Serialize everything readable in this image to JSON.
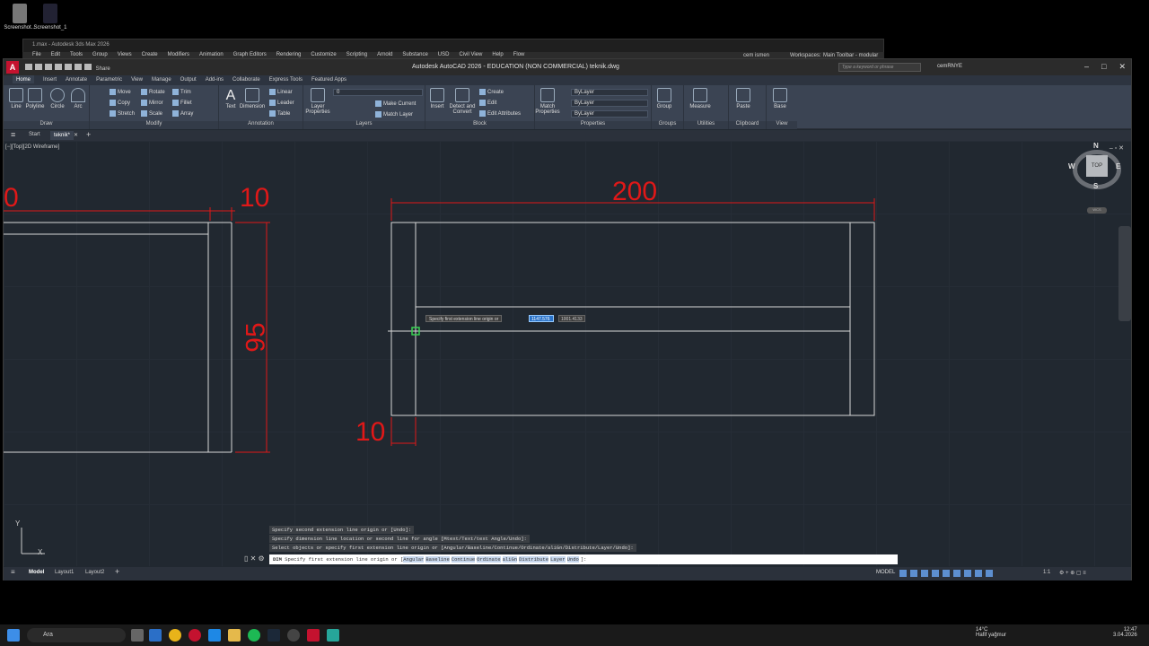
{
  "desktop": {
    "icons": [
      "Screenshot...",
      "Screenshot_1"
    ]
  },
  "max_window": {
    "title": "1.max - Autodesk 3ds Max 2026",
    "menu": [
      "File",
      "Edit",
      "Tools",
      "Group",
      "Views",
      "Create",
      "Modifiers",
      "Animation",
      "Graph Editors",
      "Rendering",
      "Customize",
      "Scripting",
      "Arnold",
      "Substance",
      "USD",
      "Civil View",
      "Help",
      "Flow"
    ],
    "user": "cem ismen",
    "workspace_label": "Workspaces:",
    "workspace_value": "Main Toolbar - modular"
  },
  "acad": {
    "title": "Autodesk AutoCAD 2026 - EDUCATION (NON COMMERCIAL)    teknik.dwg",
    "qat_share": "Share",
    "search_placeholder": "Type a keyword or phrase",
    "user": "cemRNYE",
    "ribbon_tabs": [
      "Home",
      "Insert",
      "Annotate",
      "Parametric",
      "View",
      "Manage",
      "Output",
      "Add-ins",
      "Collaborate",
      "Express Tools",
      "Featured Apps"
    ],
    "active_tab": "Home",
    "panels": {
      "draw": {
        "label": "Draw",
        "tools": [
          "Line",
          "Polyline",
          "Circle",
          "Arc"
        ]
      },
      "modify": {
        "label": "Modify",
        "tools": [
          "Move",
          "Rotate",
          "Trim",
          "Copy",
          "Mirror",
          "Fillet",
          "Stretch",
          "Scale",
          "Array"
        ]
      },
      "annotation": {
        "label": "Annotation",
        "tools": [
          "Text",
          "Dimension",
          "Linear",
          "Leader",
          "Table"
        ]
      },
      "layers": {
        "label": "Layers",
        "tools": [
          "Layer Properties",
          "Make Current",
          "Match Layer"
        ],
        "current_layer": "0"
      },
      "block": {
        "label": "Block",
        "tools": [
          "Insert",
          "Detect and Convert",
          "Create",
          "Edit",
          "Edit Attributes"
        ]
      },
      "properties": {
        "label": "Properties",
        "tools": [
          "Match Properties"
        ],
        "color": "ByLayer",
        "linetype": "ByLayer",
        "lineweight": "ByLayer"
      },
      "groups": {
        "label": "Groups",
        "tools": [
          "Group"
        ]
      },
      "utilities": {
        "label": "Utilities",
        "tools": [
          "Measure"
        ]
      },
      "clipboard": {
        "label": "Clipboard",
        "tools": [
          "Paste"
        ]
      },
      "view": {
        "label": "View",
        "tools": [
          "Base"
        ]
      }
    },
    "doc_tabs": [
      "Start",
      "teknik*"
    ],
    "viewport_label": "[−][Top][2D Wireframe]",
    "dimensions": {
      "top_width": "200",
      "left_top": "10",
      "left_partial": "0",
      "left_height": "95",
      "bottom_small": "10"
    },
    "tooltip": {
      "prompt": "Specify first extension line origin or",
      "x_value": "1147.576",
      "y_value": "1001.4133"
    },
    "viewcube": {
      "top": "TOP",
      "n": "N",
      "s": "S",
      "e": "E",
      "w": "W",
      "wcs": "WCS"
    },
    "ucs": {
      "x": "X",
      "y": "Y"
    },
    "command_history": [
      "Specify second extension line origin or [Undo]:",
      "Specify dimension line location or second line for angle [Mtext/Text/text Angle/Undo]:",
      "Select objects or specify first extension line origin or [Angular/Baseline/Continue/Ordinate/aliGn/Distribute/Layer/Undo]:"
    ],
    "command_input": {
      "prefix": "DIM",
      "prompt": "Specify first extension line origin or [",
      "options": [
        "Angular",
        "Baseline",
        "Continue",
        "Ordinate",
        "aliGn",
        "Distribute",
        "Layer",
        "Undo"
      ],
      "suffix": "]:"
    },
    "status": {
      "layout_tabs": [
        "Model",
        "Layout1",
        "Layout2"
      ],
      "active_layout": "Model",
      "mode": "MODEL",
      "scale": "1:1"
    }
  },
  "taskbar": {
    "search": "Ara",
    "weather_temp": "14°C",
    "weather_desc": "Hafif yağmur",
    "time": "12:47",
    "date": "3.04.2026"
  },
  "colors": {
    "dimension": "#e01818",
    "geometry": "#d8d8d8",
    "viewport_bg": "#212830",
    "accent": "#2a73c9"
  }
}
